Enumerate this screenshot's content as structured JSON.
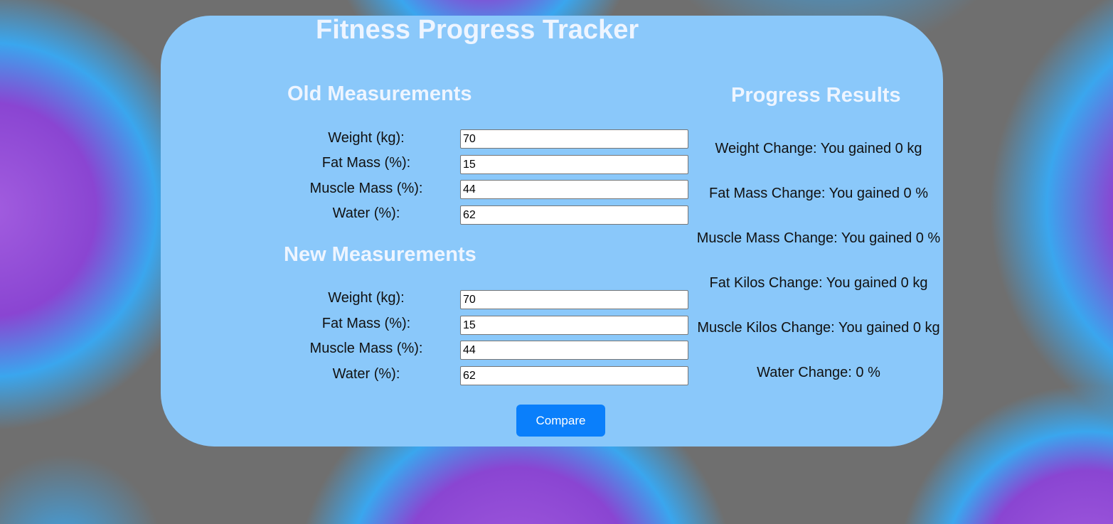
{
  "title": "Fitness Progress Tracker",
  "old": {
    "heading": "Old Measurements",
    "weight_label": "Weight (kg):",
    "weight_value": "70",
    "fat_label": "Fat Mass (%):",
    "fat_value": "15",
    "muscle_label": "Muscle Mass (%):",
    "muscle_value": "44",
    "water_label": "Water (%):",
    "water_value": "62"
  },
  "new": {
    "heading": "New Measurements",
    "weight_label": "Weight (kg):",
    "weight_value": "70",
    "fat_label": "Fat Mass (%):",
    "fat_value": "15",
    "muscle_label": "Muscle Mass (%):",
    "muscle_value": "44",
    "water_label": "Water (%):",
    "water_value": "62"
  },
  "results": {
    "heading": "Progress Results",
    "weight": "Weight Change: You gained 0 kg",
    "fat_mass": "Fat Mass Change: You gained 0 %",
    "muscle_mass": "Muscle Mass Change: You gained 0 %",
    "fat_kilos": "Fat Kilos Change: You gained 0 kg",
    "muscle_kilos": "Muscle Kilos Change: You gained 0 kg",
    "water": "Water Change: 0 %"
  },
  "compare_label": "Compare",
  "colors": {
    "card": "#8ac8fa",
    "heading": "#eef5ff",
    "button": "#0a7ffb"
  }
}
